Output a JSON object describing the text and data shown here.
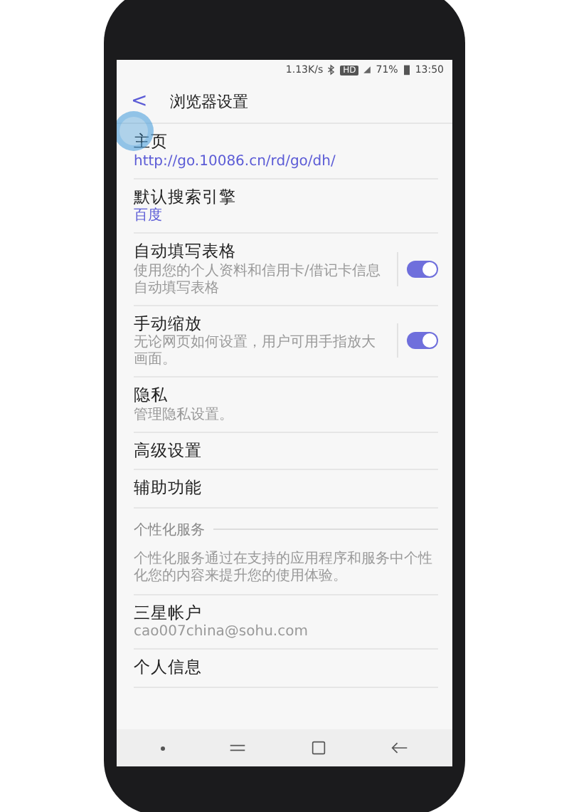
{
  "status_bar": {
    "speed": "1.13K/s",
    "hd": "HD",
    "battery": "71%",
    "time": "13:50"
  },
  "header": {
    "back": "<",
    "title": "浏览器设置"
  },
  "touch_indicator": true,
  "items": [
    {
      "kind": "setting",
      "title": "主页",
      "subtitle": "http://go.10086.cn/rd/go/dh/",
      "subtitle_accent": true
    },
    {
      "kind": "setting",
      "title": "默认搜索引擎",
      "subtitle": "百度",
      "subtitle_accent": true
    },
    {
      "kind": "toggle",
      "title": "自动填写表格",
      "subtitle": "使用您的个人资料和信用卡/借记卡信息自动填写表格",
      "on": true
    },
    {
      "kind": "toggle",
      "title": "手动缩放",
      "subtitle": "无论网页如何设置，用户可用手指放大画面。",
      "on": true
    },
    {
      "kind": "setting",
      "title": "隐私",
      "subtitle": "管理隐私设置。",
      "subtitle_accent": false
    },
    {
      "kind": "setting",
      "title": "高级设置"
    },
    {
      "kind": "setting",
      "title": "辅助功能"
    },
    {
      "kind": "section",
      "title": "个性化服务"
    },
    {
      "kind": "note",
      "title": "个性化服务通过在支持的应用程序和服务中个性化您的内容来提升您的使用体验。"
    },
    {
      "kind": "setting",
      "title": "三星帐户",
      "subtitle": "cao007china@sohu.com",
      "subtitle_accent": false
    },
    {
      "kind": "setting",
      "title": "个人信息"
    }
  ]
}
